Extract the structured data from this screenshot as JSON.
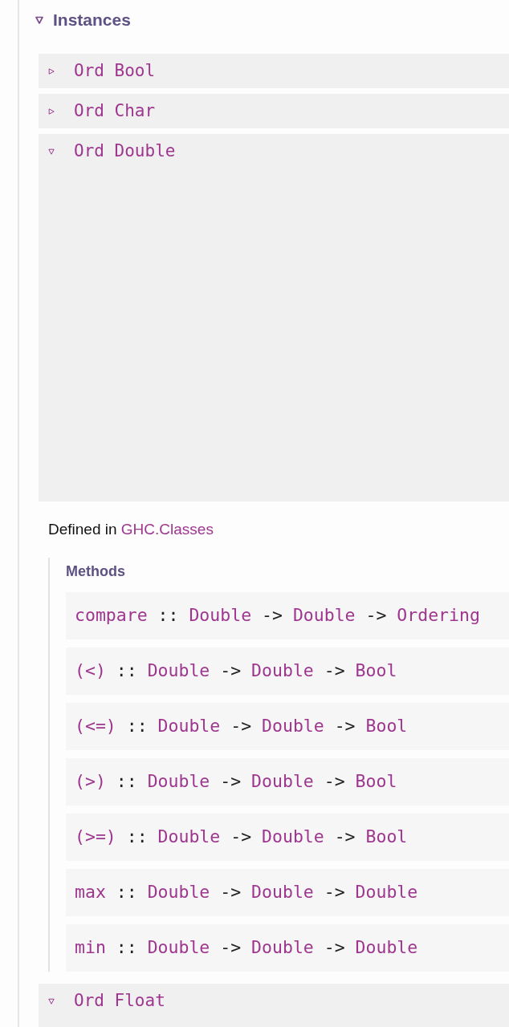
{
  "section": {
    "title": "Instances",
    "expanded": true
  },
  "instances": [
    {
      "label": "Ord Bool",
      "expanded": false
    },
    {
      "label": "Ord Char",
      "expanded": false
    },
    {
      "label": "Ord Double",
      "expanded": true,
      "defined_in": {
        "text": "Defined in",
        "module": "GHC.Classes"
      },
      "methods_title": "Methods",
      "methods": [
        {
          "tokens": [
            {
              "kind": "method",
              "text": "compare"
            },
            {
              "kind": "op",
              "text": "::"
            },
            {
              "kind": "type",
              "text": "Double"
            },
            {
              "kind": "op",
              "text": "->"
            },
            {
              "kind": "type",
              "text": "Double"
            },
            {
              "kind": "op",
              "text": "->"
            },
            {
              "kind": "type",
              "text": "Ordering"
            }
          ]
        },
        {
          "tokens": [
            {
              "kind": "method",
              "text": "(<)"
            },
            {
              "kind": "op",
              "text": "::"
            },
            {
              "kind": "type",
              "text": "Double"
            },
            {
              "kind": "op",
              "text": "->"
            },
            {
              "kind": "type",
              "text": "Double"
            },
            {
              "kind": "op",
              "text": "->"
            },
            {
              "kind": "type",
              "text": "Bool"
            }
          ]
        },
        {
          "tokens": [
            {
              "kind": "method",
              "text": "(<=)"
            },
            {
              "kind": "op",
              "text": "::"
            },
            {
              "kind": "type",
              "text": "Double"
            },
            {
              "kind": "op",
              "text": "->"
            },
            {
              "kind": "type",
              "text": "Double"
            },
            {
              "kind": "op",
              "text": "->"
            },
            {
              "kind": "type",
              "text": "Bool"
            }
          ]
        },
        {
          "tokens": [
            {
              "kind": "method",
              "text": "(>)"
            },
            {
              "kind": "op",
              "text": "::"
            },
            {
              "kind": "type",
              "text": "Double"
            },
            {
              "kind": "op",
              "text": "->"
            },
            {
              "kind": "type",
              "text": "Double"
            },
            {
              "kind": "op",
              "text": "->"
            },
            {
              "kind": "type",
              "text": "Bool"
            }
          ]
        },
        {
          "tokens": [
            {
              "kind": "method",
              "text": "(>=)"
            },
            {
              "kind": "op",
              "text": "::"
            },
            {
              "kind": "type",
              "text": "Double"
            },
            {
              "kind": "op",
              "text": "->"
            },
            {
              "kind": "type",
              "text": "Double"
            },
            {
              "kind": "op",
              "text": "->"
            },
            {
              "kind": "type",
              "text": "Bool"
            }
          ]
        },
        {
          "tokens": [
            {
              "kind": "method",
              "text": "max"
            },
            {
              "kind": "op",
              "text": "::"
            },
            {
              "kind": "type",
              "text": "Double"
            },
            {
              "kind": "op",
              "text": "->"
            },
            {
              "kind": "type",
              "text": "Double"
            },
            {
              "kind": "op",
              "text": "->"
            },
            {
              "kind": "type",
              "text": "Double"
            }
          ]
        },
        {
          "tokens": [
            {
              "kind": "method",
              "text": "min"
            },
            {
              "kind": "op",
              "text": "::"
            },
            {
              "kind": "type",
              "text": "Double"
            },
            {
              "kind": "op",
              "text": "->"
            },
            {
              "kind": "type",
              "text": "Double"
            },
            {
              "kind": "op",
              "text": "->"
            },
            {
              "kind": "type",
              "text": "Double"
            }
          ]
        }
      ]
    },
    {
      "label": "Ord Float",
      "expanded": true
    }
  ]
}
